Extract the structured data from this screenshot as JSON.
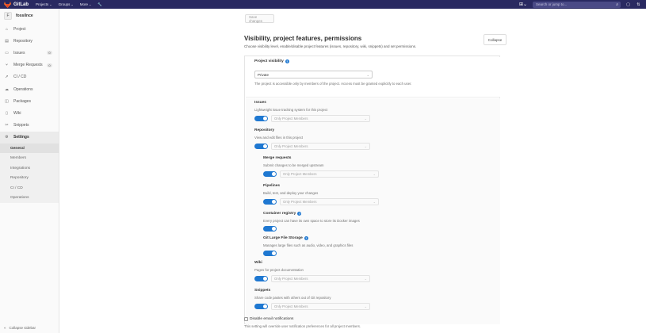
{
  "topbar": {
    "brand": "GitLab",
    "nav": [
      {
        "label": "Projects"
      },
      {
        "label": "Groups"
      },
      {
        "label": "More"
      }
    ],
    "search_placeholder": "Search or jump to..."
  },
  "sidebar": {
    "project_initial": "F",
    "project_name": "fossilnce",
    "items": [
      {
        "label": "Project",
        "icon": "home-icon"
      },
      {
        "label": "Repository",
        "icon": "book-icon"
      },
      {
        "label": "Issues",
        "icon": "issues-icon",
        "badge": "0"
      },
      {
        "label": "Merge Requests",
        "icon": "merge-request-icon",
        "badge": "0"
      },
      {
        "label": "CI / CD",
        "icon": "rocket-icon"
      },
      {
        "label": "Operations",
        "icon": "cloud-gear-icon"
      },
      {
        "label": "Packages",
        "icon": "package-icon"
      },
      {
        "label": "Wiki",
        "icon": "book-open-icon"
      },
      {
        "label": "Snippets",
        "icon": "scissors-icon"
      },
      {
        "label": "Settings",
        "icon": "gear-icon"
      }
    ],
    "settings_sub": [
      "General",
      "Members",
      "Integrations",
      "Repository",
      "CI / CD",
      "Operations"
    ],
    "collapse_label": "Collapse sidebar"
  },
  "main": {
    "save_label": "Save changes",
    "section_title": "Visibility, project features, permissions",
    "section_desc": "Choose visibility level, enable/disable project features (issues, repository, wiki, snippets) and set permissions.",
    "collapse_label": "Collapse",
    "visibility_label": "Project visibility",
    "visibility_value": "Private",
    "visibility_help": "The project is accessible only by members of the project. Access must be granted explicitly to each user.",
    "access_value": "Only Project Members",
    "features": {
      "issues": {
        "title": "Issues",
        "desc": "Lightweight issue tracking system for this project"
      },
      "repository": {
        "title": "Repository",
        "desc": "View and edit files in this project"
      },
      "merge_requests": {
        "title": "Merge requests",
        "desc": "Submit changes to be merged upstream"
      },
      "pipelines": {
        "title": "Pipelines",
        "desc": "Build, test, and deploy your changes"
      },
      "container_registry": {
        "title": "Container registry",
        "desc": "Every project can have its own space to store its Docker images"
      },
      "lfs": {
        "title": "Git Large File Storage",
        "desc": "Manages large files such as audio, video, and graphics files"
      },
      "wiki": {
        "title": "Wiki",
        "desc": "Pages for project documentation"
      },
      "snippets": {
        "title": "Snippets",
        "desc": "Share code pastes with others out of Git repository"
      }
    },
    "email_label": "Disable email notifications",
    "email_help": "This setting will override user notification preferences for all project members."
  },
  "colors": {
    "topbar": "#292961",
    "accent": "#1f78d1"
  }
}
